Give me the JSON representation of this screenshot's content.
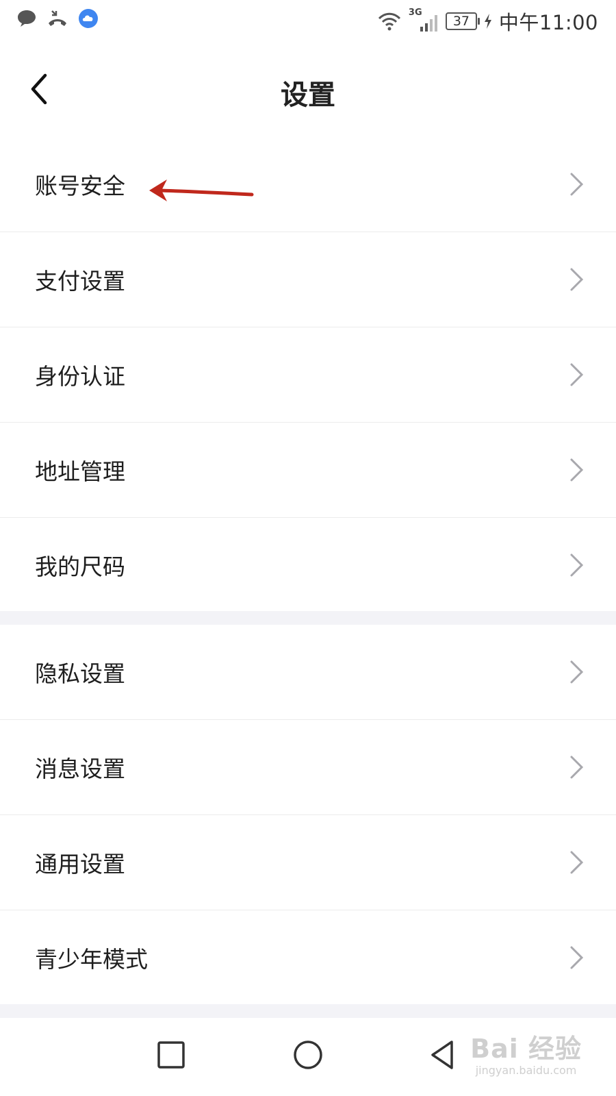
{
  "status_bar": {
    "time": "中午11:00",
    "battery": "37",
    "network": "3G",
    "icons": [
      "message-icon",
      "missed-call-icon",
      "cloud-app-icon",
      "wifi-icon",
      "signal-icon",
      "charging-icon"
    ]
  },
  "header": {
    "title": "设置"
  },
  "settings": {
    "group1": [
      {
        "label": "账号安全"
      },
      {
        "label": "支付设置"
      },
      {
        "label": "身份认证"
      },
      {
        "label": "地址管理"
      },
      {
        "label": "我的尺码"
      }
    ],
    "group2": [
      {
        "label": "隐私设置"
      },
      {
        "label": "消息设置"
      },
      {
        "label": "通用设置"
      },
      {
        "label": "青少年模式"
      }
    ]
  },
  "annotation": {
    "color": "#c0281c"
  },
  "watermark": {
    "brand": "Bai 经验",
    "url": "jingyan.baidu.com"
  },
  "colors": {
    "separator": "#ececec",
    "group_gap": "#f3f3f7",
    "chevron": "#a8a8ad"
  }
}
